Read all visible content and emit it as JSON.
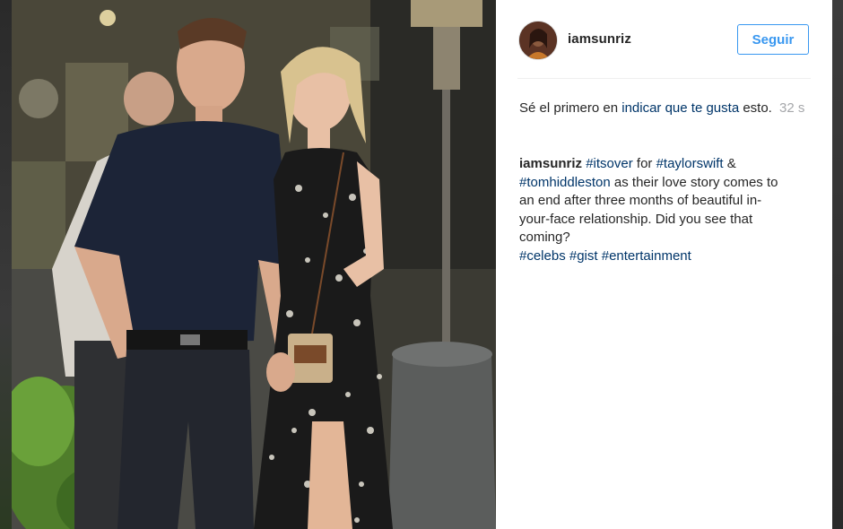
{
  "post": {
    "photo_alt": "Couple walking at night on a city street",
    "author": {
      "username": "iamsunriz",
      "avatar_icon": "profile-photo"
    },
    "follow_label": "Seguir",
    "likes": {
      "prefix": "Sé el primero en ",
      "link": "indicar que te gusta",
      "suffix": " esto."
    },
    "timestamp": "32 s",
    "caption": {
      "author": "iamsunriz",
      "tag_itsover": "#itsover",
      "text_for": " for ",
      "tag_taylorswift": "#taylorswift",
      "text_amp": " & ",
      "tag_tomhiddleston": "#tomhiddleston",
      "body": " as their love story comes to an end after three months of beautiful in-your-face relationship. Did you see that coming?",
      "tag_celebs": "#celebs",
      "tag_gist": "#gist",
      "tag_entertainment": "#entertainment"
    }
  },
  "colors": {
    "link": "#003569",
    "accent": "#3897f0",
    "text": "#262626",
    "muted": "#a5a7aa",
    "panel_bg": "#ffffff"
  }
}
